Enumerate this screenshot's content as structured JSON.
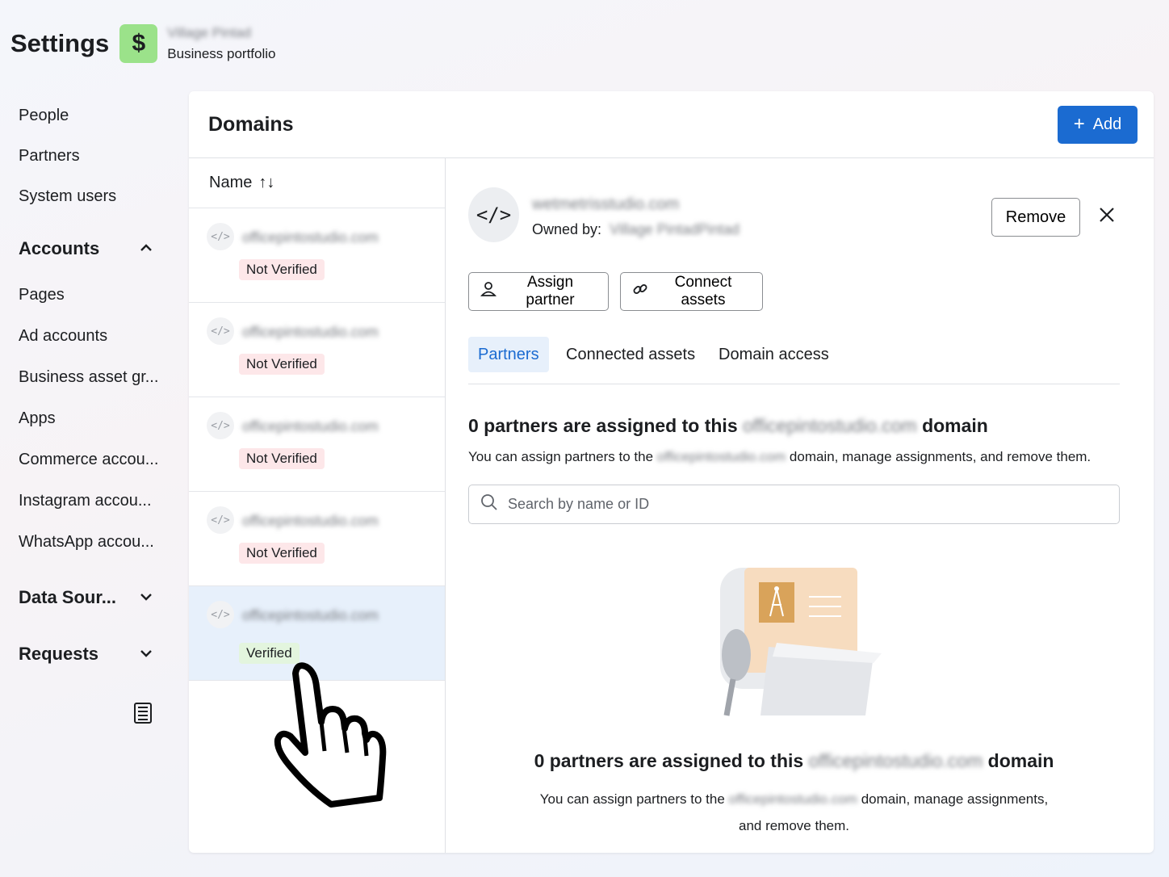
{
  "header": {
    "title": "Settings",
    "portfolio_icon": "$",
    "portfolio_name": "Village Pintad",
    "portfolio_sub": "Business portfolio"
  },
  "sidebar": {
    "items_top": [
      "People",
      "Partners",
      "System users"
    ],
    "accounts_label": "Accounts",
    "account_items": [
      "Pages",
      "Ad accounts",
      "Business asset gr...",
      "Apps",
      "Commerce accou...",
      "Instagram accou...",
      "WhatsApp accou..."
    ],
    "data_sources_label": "Data Sour...",
    "requests_label": "Requests"
  },
  "panel": {
    "title": "Domains",
    "add_label": "Add"
  },
  "list": {
    "sort_label": "Name",
    "rows": [
      {
        "name": "officepintostudio.com",
        "status": "Not Verified"
      },
      {
        "name": "officepintostudio.com",
        "status": "Not Verified"
      },
      {
        "name": "officepintostudio.com",
        "status": "Not Verified"
      },
      {
        "name": "officepintostudio.com",
        "status": "Not Verified"
      },
      {
        "name": "officepintostudio.com",
        "status": "Verified"
      }
    ]
  },
  "detail": {
    "domain": "wetmetrisstudio.com",
    "owned_by_label": "Owned by:",
    "owner": "Village PintadPintad",
    "remove_label": "Remove",
    "assign_partner_label": "Assign partner",
    "connect_assets_label": "Connect assets",
    "tabs": [
      "Partners",
      "Connected assets",
      "Domain access"
    ],
    "heading_prefix": "0 partners are assigned to this",
    "heading_domain": "officepintostudio.com",
    "heading_suffix": "domain",
    "sub_prefix": "You can assign partners to the",
    "sub_domain": "officepintostudio.com",
    "sub_suffix": "domain, manage assignments, and remove them.",
    "search_placeholder": "Search by name or ID",
    "empty_heading_prefix": "0 partners are assigned to this",
    "empty_heading_domain": "officepintostudio.com",
    "empty_heading_suffix": "domain",
    "empty_text_prefix": "You can assign partners to the",
    "empty_text_domain": "officepintostudio.com",
    "empty_text_suffix": "domain, manage assignments,",
    "empty_text_line2": "and remove them."
  },
  "colors": {
    "accent": "#1b6bd1",
    "portfolio_icon_bg": "#9be28a",
    "not_verified_bg": "#fde7e9",
    "verified_bg": "#e3f5de",
    "selected_row_bg": "#e7f0fb"
  }
}
